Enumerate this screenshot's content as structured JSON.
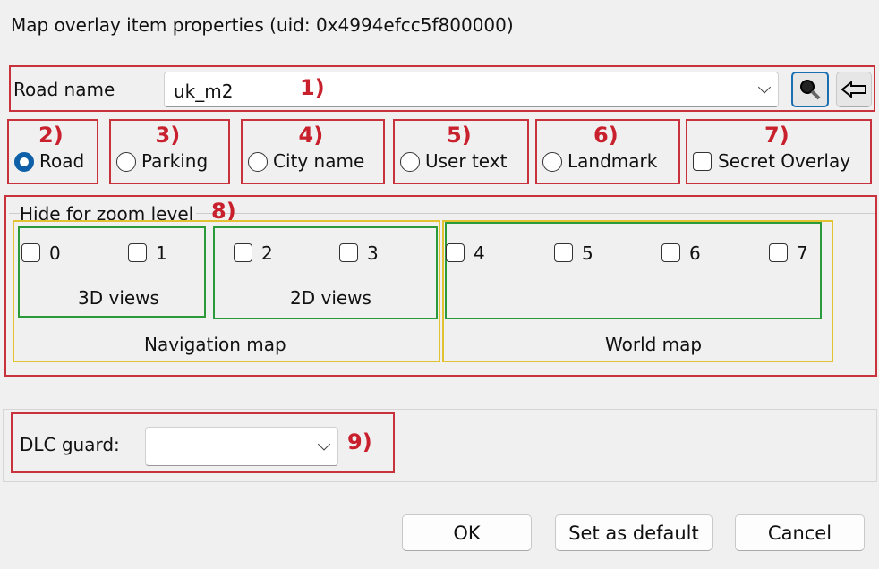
{
  "window": {
    "title": "Map overlay item properties (uid: 0x4994efcc5f800000)"
  },
  "road": {
    "label": "Road name",
    "value": "uk_m2",
    "marker": "1)",
    "search_icon": "magnifier-icon",
    "back_icon": "arrow-left-icon"
  },
  "types": [
    {
      "marker": "2)",
      "label": "Road",
      "kind": "radio",
      "checked": true
    },
    {
      "marker": "3)",
      "label": "Parking",
      "kind": "radio",
      "checked": false
    },
    {
      "marker": "4)",
      "label": "City name",
      "kind": "radio",
      "checked": false
    },
    {
      "marker": "5)",
      "label": "User text",
      "kind": "radio",
      "checked": false
    },
    {
      "marker": "6)",
      "label": "Landmark",
      "kind": "radio",
      "checked": false
    },
    {
      "marker": "7)",
      "label": "Secret Overlay",
      "kind": "checkbox",
      "checked": false
    }
  ],
  "zoom": {
    "title": "Hide for zoom level",
    "marker": "8)",
    "levels": [
      "0",
      "1",
      "2",
      "3",
      "4",
      "5",
      "6",
      "7"
    ],
    "groups": {
      "views3d": "3D views",
      "views2d": "2D views",
      "nav": "Navigation map",
      "world": "World map"
    }
  },
  "dlc": {
    "label": "DLC guard:",
    "value": "",
    "marker": "9)"
  },
  "buttons": {
    "ok": "OK",
    "default": "Set as default",
    "cancel": "Cancel"
  },
  "colors": {
    "annotation": "#c8323c",
    "accent": "#0d5fa8"
  }
}
